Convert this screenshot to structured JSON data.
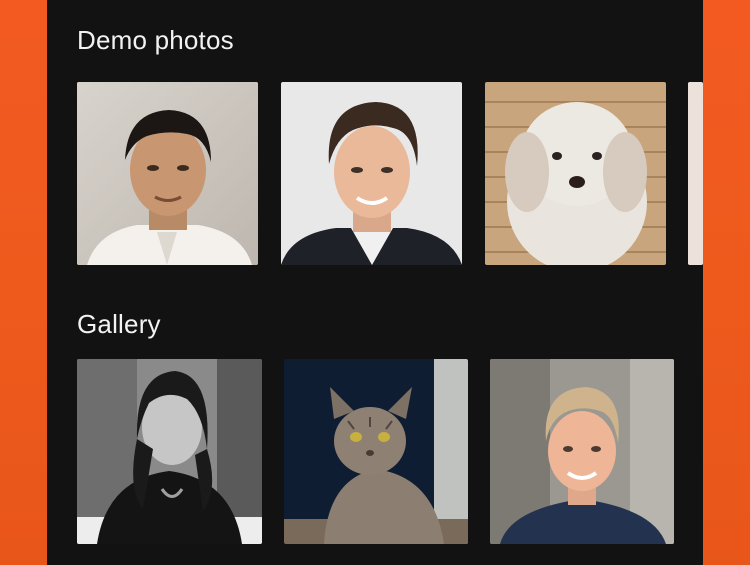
{
  "sections": {
    "demo": {
      "title": "Demo photos",
      "items": [
        {
          "name": "demo-photo-man-1",
          "description": "Portrait of a smiling man with dark hair in a white high-collar jacket"
        },
        {
          "name": "demo-photo-man-2",
          "description": "Portrait of a smiling man with dark hair in a dark suit"
        },
        {
          "name": "demo-photo-dog",
          "description": "Fluffy light-colored dog in front of a wooden fence"
        },
        {
          "name": "demo-photo-partial",
          "description": "Partially visible next photo"
        }
      ]
    },
    "gallery": {
      "title": "Gallery",
      "items": [
        {
          "name": "gallery-photo-woman",
          "description": "Black and white photo of a woman with long dark hair"
        },
        {
          "name": "gallery-photo-cat",
          "description": "Tabby cat sitting on a dark background"
        },
        {
          "name": "gallery-photo-young-man",
          "description": "Smiling young man with light hair in a navy t-shirt"
        }
      ]
    }
  },
  "colors": {
    "background_accent": "#f05a20",
    "screen_bg": "#121212",
    "title_text": "#f2f2f2"
  }
}
